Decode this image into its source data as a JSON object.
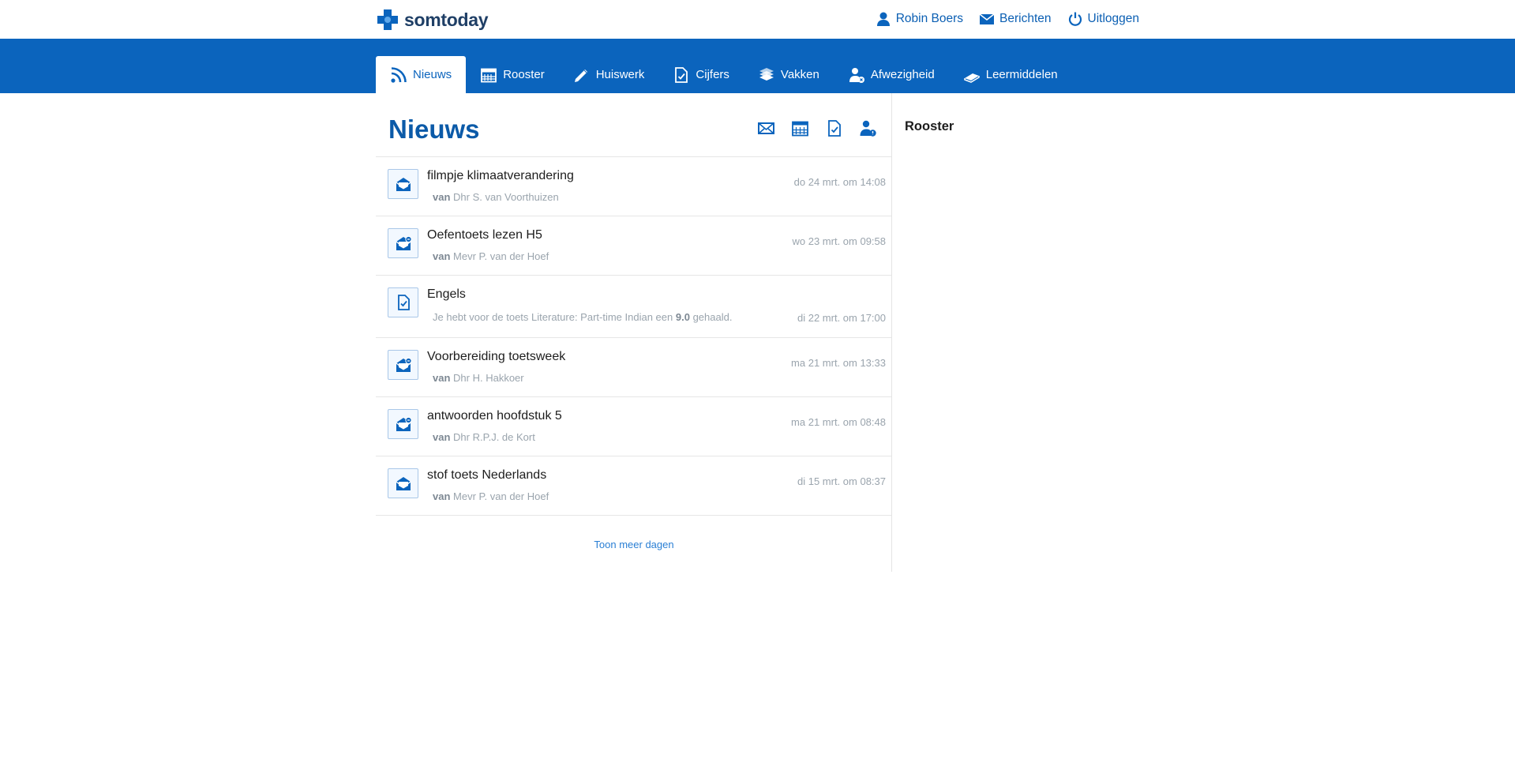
{
  "brand": {
    "name": "somtoday",
    "color": "#0b64bd"
  },
  "user_nav": {
    "user": "Robin Boers",
    "messages": "Berichten",
    "logout": "Uitloggen"
  },
  "tabs": [
    {
      "label": "Nieuws",
      "icon": "rss-icon",
      "active": true
    },
    {
      "label": "Rooster",
      "icon": "calendar-icon",
      "active": false
    },
    {
      "label": "Huiswerk",
      "icon": "pencil-icon",
      "active": false
    },
    {
      "label": "Cijfers",
      "icon": "grade-document-icon",
      "active": false
    },
    {
      "label": "Vakken",
      "icon": "books-icon",
      "active": false
    },
    {
      "label": "Afwezigheid",
      "icon": "absence-user-icon",
      "active": false
    },
    {
      "label": "Leermiddelen",
      "icon": "book-icon",
      "active": false
    }
  ],
  "main": {
    "title": "Nieuws",
    "filter_icons": [
      "mail-icon",
      "calendar-icon",
      "grade-document-icon",
      "absence-user-icon"
    ],
    "items": [
      {
        "icon": "open-envelope-icon",
        "title": "filmpje klimaatverandering",
        "prefix": "van",
        "from": "Dhr S. van Voorthuizen",
        "date": "do 24 mrt. om 14:08"
      },
      {
        "icon": "open-envelope-attachment-icon",
        "title": "Oefentoets lezen H5",
        "prefix": "van",
        "from": "Mevr P. van der Hoef",
        "date": "wo 23 mrt. om 09:58"
      },
      {
        "icon": "grade-document-icon",
        "title": "Engels",
        "sub_text_before": "Je hebt voor de toets Literature: Part-time Indian een",
        "grade": "9.0",
        "sub_text_after": "gehaald.",
        "date": "di 22 mrt. om 17:00"
      },
      {
        "icon": "open-envelope-attachment-icon",
        "title": "Voorbereiding toetsweek",
        "prefix": "van",
        "from": "Dhr H. Hakkoer",
        "date": "ma 21 mrt. om 13:33"
      },
      {
        "icon": "open-envelope-attachment-icon",
        "title": "antwoorden hoofdstuk 5",
        "prefix": "van",
        "from": "Dhr R.P.J. de Kort",
        "date": "ma 21 mrt. om 08:48"
      },
      {
        "icon": "open-envelope-icon",
        "title": "stof toets Nederlands",
        "prefix": "van",
        "from": "Mevr P. van der Hoef",
        "date": "di 15 mrt. om 08:37"
      }
    ],
    "more_link": "Toon meer dagen"
  },
  "side": {
    "title": "Rooster"
  }
}
